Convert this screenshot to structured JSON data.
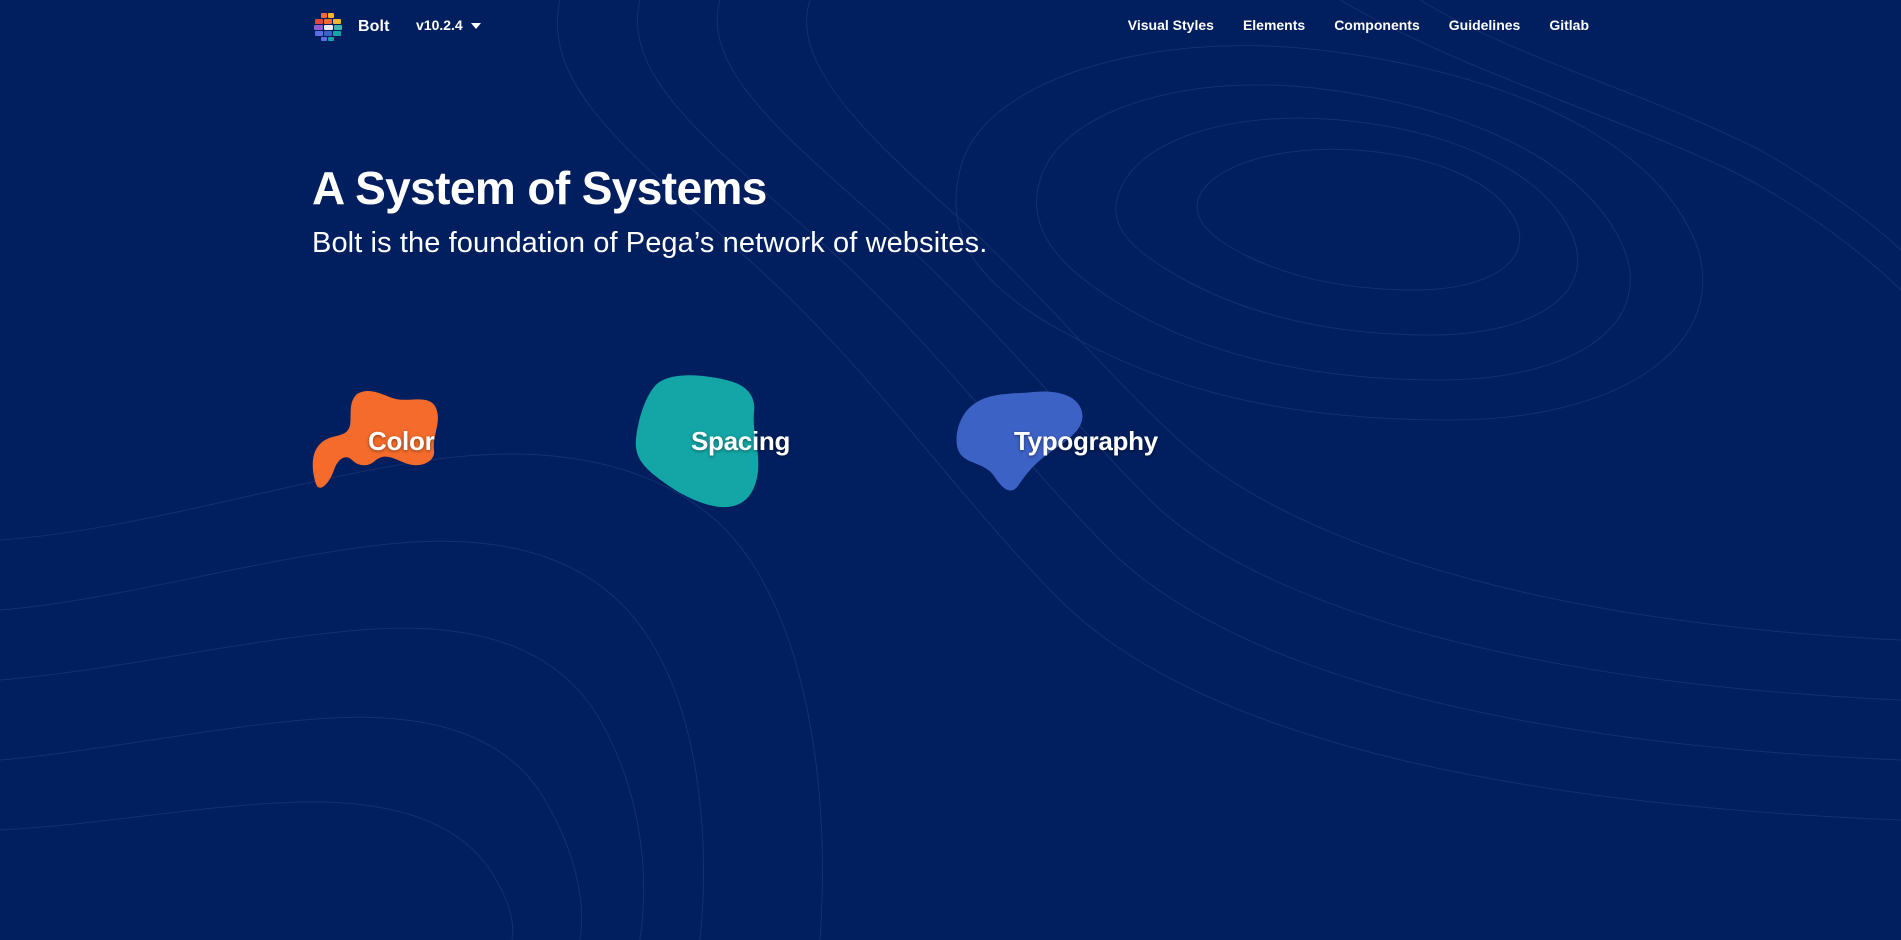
{
  "header": {
    "brand_name": "Bolt",
    "version_label": "v10.2.4",
    "nav": [
      {
        "label": "Visual Styles"
      },
      {
        "label": "Elements"
      },
      {
        "label": "Components"
      },
      {
        "label": "Guidelines"
      },
      {
        "label": "Gitlab"
      }
    ]
  },
  "hero": {
    "title": "A System of Systems",
    "subtitle": "Bolt is the foundation of Pega’s network of websites."
  },
  "tiles": [
    {
      "label": "Color",
      "color": "#f46b2b"
    },
    {
      "label": "Spacing",
      "color": "#14a6a6"
    },
    {
      "label": "Typography",
      "color": "#3d62c6"
    }
  ],
  "colors": {
    "background": "#011e5e",
    "contour_line": "#1b3775",
    "text": "#ffffff"
  },
  "icons": {
    "logo": "bolt-logo-icon",
    "version_dropdown": "caret-down-icon"
  }
}
